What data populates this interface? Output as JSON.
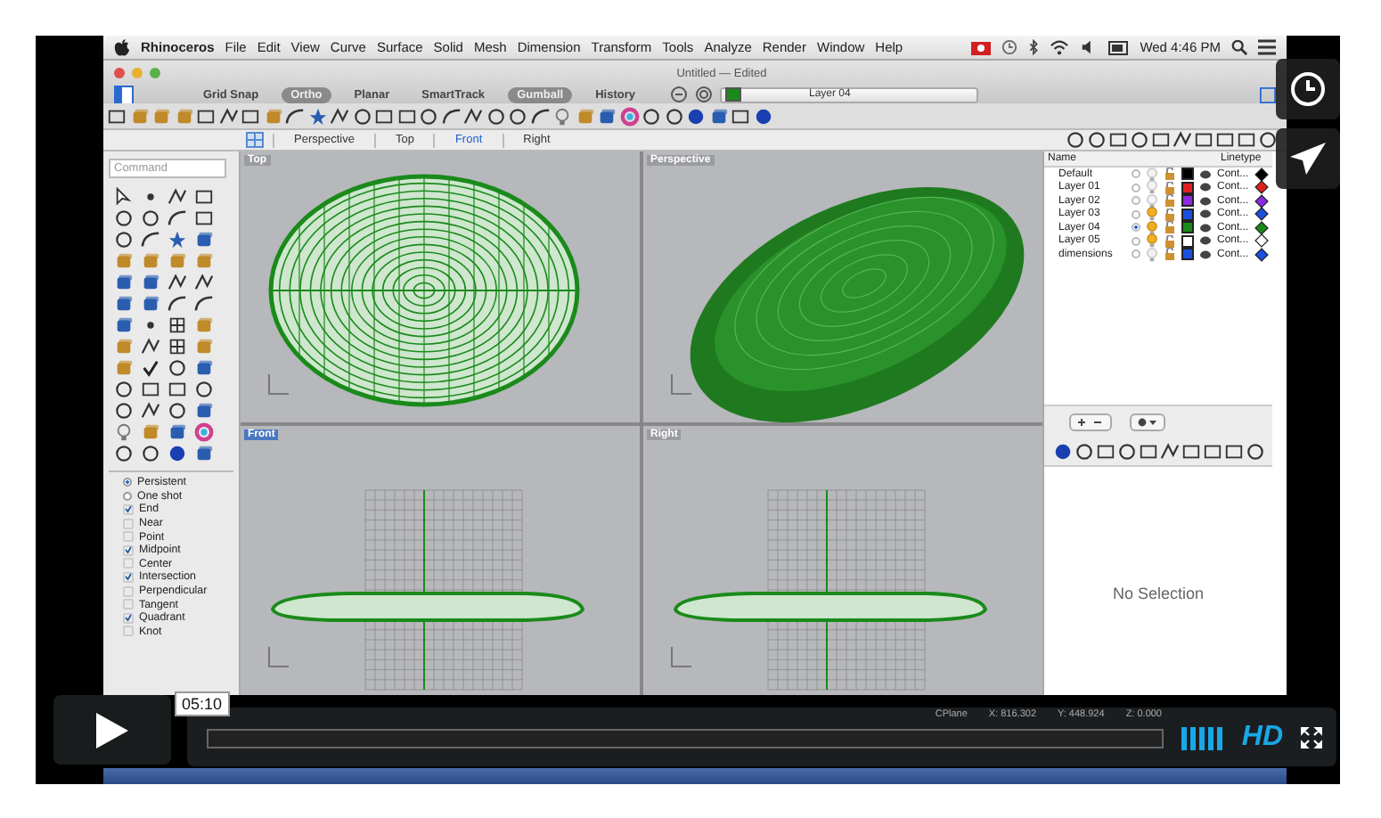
{
  "menu_bar": {
    "app": "Rhinoceros",
    "items": [
      "File",
      "Edit",
      "View",
      "Curve",
      "Surface",
      "Solid",
      "Mesh",
      "Dimension",
      "Transform",
      "Tools",
      "Analyze",
      "Render",
      "Window",
      "Help"
    ],
    "clock": "Wed 4:46 PM"
  },
  "window": {
    "title": "Untitled — Edited",
    "modes": [
      {
        "label": "Grid Snap",
        "selected": false
      },
      {
        "label": "Ortho",
        "selected": true
      },
      {
        "label": "Planar",
        "selected": false
      },
      {
        "label": "SmartTrack",
        "selected": false
      },
      {
        "label": "Gumball",
        "selected": true
      },
      {
        "label": "History",
        "selected": false
      }
    ],
    "current_layer": {
      "name": "Layer 04",
      "color": "#1a8a1a"
    }
  },
  "viewport_tabs": [
    {
      "label": "Perspective",
      "selected": false
    },
    {
      "label": "Top",
      "selected": false
    },
    {
      "label": "Front",
      "selected": true
    },
    {
      "label": "Right",
      "selected": false
    }
  ],
  "command": {
    "placeholder": "Command"
  },
  "osnap": {
    "modes": [
      {
        "label": "Persistent",
        "selected": true
      },
      {
        "label": "One shot",
        "selected": false
      }
    ],
    "snaps": [
      {
        "label": "End",
        "checked": true
      },
      {
        "label": "Near",
        "checked": false
      },
      {
        "label": "Point",
        "checked": false
      },
      {
        "label": "Midpoint",
        "checked": true
      },
      {
        "label": "Center",
        "checked": false
      },
      {
        "label": "Intersection",
        "checked": true
      },
      {
        "label": "Perpendicular",
        "checked": false
      },
      {
        "label": "Tangent",
        "checked": false
      },
      {
        "label": "Quadrant",
        "checked": true
      },
      {
        "label": "Knot",
        "checked": false
      }
    ]
  },
  "viewports": [
    {
      "title": "Top",
      "kind": "top",
      "selected": false
    },
    {
      "title": "Perspective",
      "kind": "perspective",
      "selected": false
    },
    {
      "title": "Front",
      "kind": "front",
      "selected": true
    },
    {
      "title": "Right",
      "kind": "right",
      "selected": false
    }
  ],
  "layers": {
    "columns": [
      "Name",
      "Linetype"
    ],
    "rows": [
      {
        "name": "Default",
        "current": false,
        "on": false,
        "color": "#000000",
        "linetype": "Cont..."
      },
      {
        "name": "Layer 01",
        "current": false,
        "on": false,
        "color": "#e02020",
        "linetype": "Cont..."
      },
      {
        "name": "Layer 02",
        "current": false,
        "on": false,
        "color": "#8a2be2",
        "linetype": "Cont..."
      },
      {
        "name": "Layer 03",
        "current": false,
        "on": true,
        "color": "#1a4fe0",
        "linetype": "Cont..."
      },
      {
        "name": "Layer 04",
        "current": true,
        "on": true,
        "color": "#1a8a1a",
        "linetype": "Cont..."
      },
      {
        "name": "Layer 05",
        "current": false,
        "on": true,
        "color": "#ffffff",
        "linetype": "Cont..."
      },
      {
        "name": "dimensions",
        "current": false,
        "on": false,
        "color": "#1a4fe0",
        "linetype": "Cont..."
      }
    ]
  },
  "properties": {
    "message": "No Selection"
  },
  "status_bar": {
    "cplane": "CPlane",
    "x": "X: 816.302",
    "y": "Y: 448.924",
    "z": "Z: 0.000"
  },
  "player": {
    "time": "05:10",
    "hd": "HD"
  }
}
